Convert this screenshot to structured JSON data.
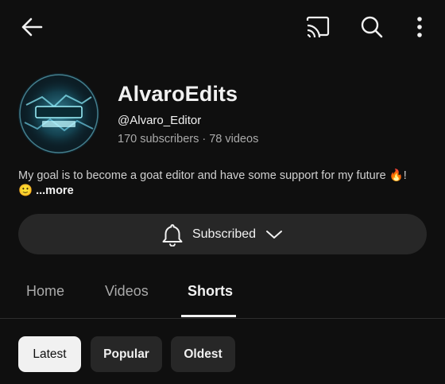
{
  "topbar": {
    "back_icon": "arrow-left-icon",
    "cast_icon": "cast-icon",
    "search_icon": "search-icon",
    "more_icon": "more-vertical-icon"
  },
  "channel": {
    "name": "AlvaroEdits",
    "handle": "@Alvaro_Editor",
    "stats": "170 subscribers · 78 videos",
    "description": "My goal is to become a goat editor and have some support for my future 🔥! 🙂",
    "more_label": "...more"
  },
  "subscribe": {
    "label": "Subscribed",
    "bell_icon": "bell-icon",
    "chevron_icon": "chevron-down-icon"
  },
  "tabs": [
    {
      "label": "Home"
    },
    {
      "label": "Videos"
    },
    {
      "label": "Shorts"
    }
  ],
  "chips": [
    {
      "label": "Latest"
    },
    {
      "label": "Popular"
    },
    {
      "label": "Oldest"
    }
  ],
  "colors": {
    "background": "#0f0f0f",
    "surface": "#272727",
    "text_primary": "#f1f1f1",
    "text_secondary": "#aaaaaa"
  }
}
